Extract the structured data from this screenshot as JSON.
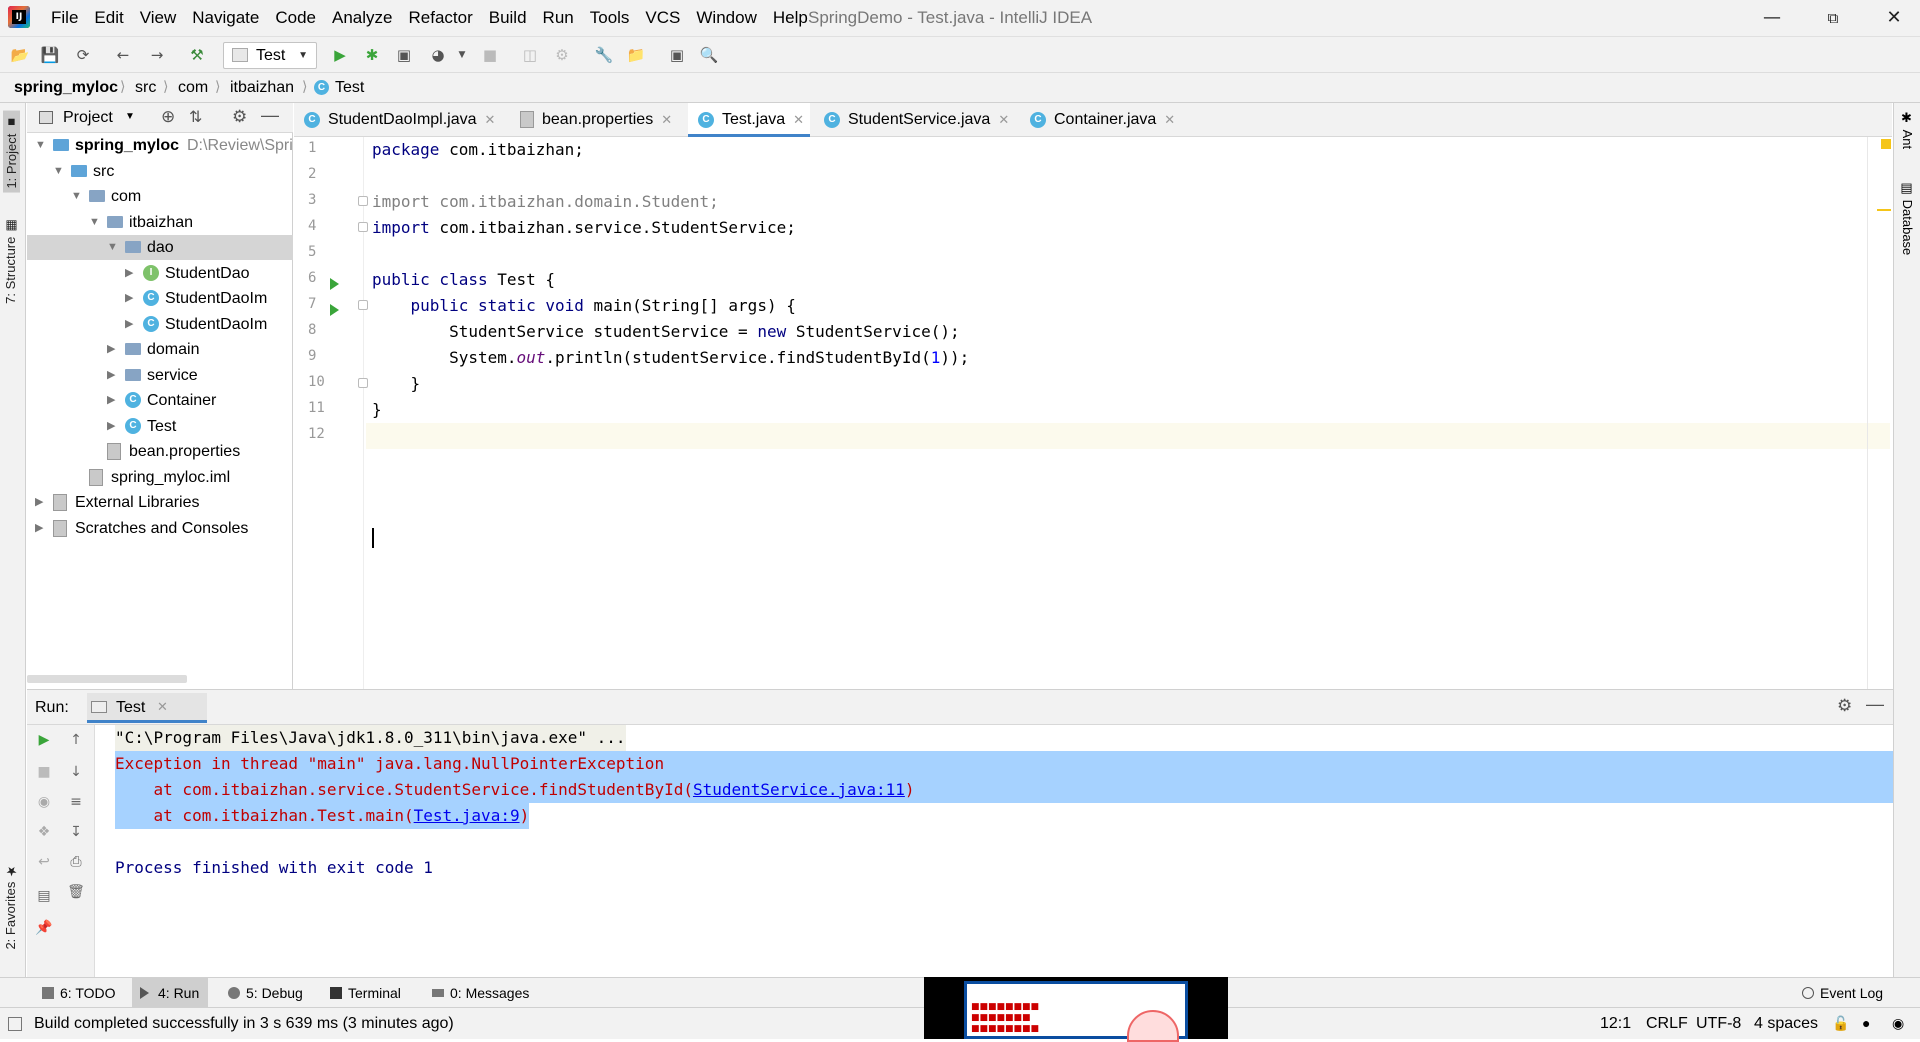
{
  "window": {
    "title": "SpringDemo - Test.java - IntelliJ IDEA",
    "logo_text": "IJ"
  },
  "menu": [
    "File",
    "Edit",
    "View",
    "Navigate",
    "Code",
    "Analyze",
    "Refactor",
    "Build",
    "Run",
    "Tools",
    "VCS",
    "Window",
    "Help"
  ],
  "toolbar": {
    "run_config": "Test"
  },
  "breadcrumb": [
    "spring_myloc",
    "src",
    "com",
    "itbaizhan",
    "Test"
  ],
  "project_panel": {
    "title": "Project",
    "tree": [
      {
        "label": "spring_myloc",
        "hint": "D:\\Review\\Spri",
        "depth": 0,
        "icon": "module-icon",
        "expanded": true,
        "bold": true
      },
      {
        "label": "src",
        "depth": 1,
        "icon": "source-folder-icon",
        "expanded": true
      },
      {
        "label": "com",
        "depth": 2,
        "icon": "package-icon",
        "expanded": true
      },
      {
        "label": "itbaizhan",
        "depth": 3,
        "icon": "package-icon",
        "expanded": true
      },
      {
        "label": "dao",
        "depth": 4,
        "icon": "package-icon",
        "expanded": true,
        "selected": true
      },
      {
        "label": "StudentDao",
        "depth": 5,
        "icon": "interface-icon",
        "expanded": false
      },
      {
        "label": "StudentDaoIm",
        "depth": 5,
        "icon": "class-icon",
        "expanded": false
      },
      {
        "label": "StudentDaoIm",
        "depth": 5,
        "icon": "class-icon",
        "expanded": false
      },
      {
        "label": "domain",
        "depth": 4,
        "icon": "package-icon",
        "expanded": false
      },
      {
        "label": "service",
        "depth": 4,
        "icon": "package-icon",
        "expanded": false
      },
      {
        "label": "Container",
        "depth": 4,
        "icon": "class-icon",
        "expanded": false
      },
      {
        "label": "Test",
        "depth": 4,
        "icon": "runnable-class-icon",
        "expanded": false
      },
      {
        "label": "bean.properties",
        "depth": 3,
        "icon": "properties-file-icon",
        "leaf": true
      },
      {
        "label": "spring_myloc.iml",
        "depth": 2,
        "icon": "iml-file-icon",
        "leaf": true
      },
      {
        "label": "External Libraries",
        "depth": 0,
        "icon": "library-icon",
        "expanded": false
      },
      {
        "label": "Scratches and Consoles",
        "depth": 0,
        "icon": "scratches-icon",
        "expanded": false
      }
    ]
  },
  "editor_tabs": [
    {
      "label": "StudentDaoImpl.java",
      "icon": "class-icon",
      "active": false
    },
    {
      "label": "bean.properties",
      "icon": "properties-file-icon",
      "active": false
    },
    {
      "label": "Test.java",
      "icon": "runnable-class-icon",
      "active": true
    },
    {
      "label": "StudentService.java",
      "icon": "class-icon",
      "active": false
    },
    {
      "label": "Container.java",
      "icon": "class-icon",
      "active": false
    }
  ],
  "code_lines": [
    {
      "n": "1"
    },
    {
      "n": "2"
    },
    {
      "n": "3"
    },
    {
      "n": "4"
    },
    {
      "n": "5"
    },
    {
      "n": "6"
    },
    {
      "n": "7"
    },
    {
      "n": "8"
    },
    {
      "n": "9"
    },
    {
      "n": "10"
    },
    {
      "n": "11"
    },
    {
      "n": "12"
    }
  ],
  "code": {
    "l1_kw": "package",
    "l1_rest": " com.itbaizhan;",
    "l3": "import com.itbaizhan.domain.Student;",
    "l4_kw": "import",
    "l4_rest": " com.itbaizhan.service.StudentService;",
    "l6_kw": "public class",
    "l6_rest": " Test {",
    "l7_kw": "    public static void",
    "l7_rest": " main(String[] args) {",
    "l8_a": "        StudentService studentService = ",
    "l8_kw": "new",
    "l8_b": " StudentService();",
    "l9_a": "        System.",
    "l9_out": "out",
    "l9_b": ".println(studentService.findStudentById(",
    "l9_num": "1",
    "l9_c": "));",
    "l10": "    }",
    "l11": "}"
  },
  "run_panel": {
    "label": "Run:",
    "tab": "Test",
    "console": {
      "cmd": "\"C:\\Program Files\\Java\\jdk1.8.0_311\\bin\\java.exe\" ...",
      "exception": "Exception in thread \"main\" java.lang.NullPointerException",
      "trace1_pre": "    at com.itbaizhan.service.StudentService.findStudentById(",
      "trace1_link": "StudentService.java:11",
      "trace1_post": ")",
      "trace2_pre": "    at com.itbaizhan.Test.main(",
      "trace2_link": "Test.java:9",
      "trace2_post": ")",
      "finish": "Process finished with exit code 1"
    }
  },
  "tool_windows_bottom": [
    {
      "label": "6: TODO",
      "active": false
    },
    {
      "label": "4: Run",
      "active": true
    },
    {
      "label": "5: Debug",
      "active": false
    },
    {
      "label": "Terminal",
      "active": false
    },
    {
      "label": "0: Messages",
      "active": false
    }
  ],
  "event_log": "Event Log",
  "side_tabs": {
    "left_project": "1: Project",
    "left_structure": "7: Structure",
    "left_favorites": "2: Favorites",
    "right_ant": "Ant",
    "right_database": "Database"
  },
  "status": {
    "message": "Build completed successfully in 3 s 639 ms (3 minutes ago)",
    "position": "12:1",
    "line_sep": "CRLF",
    "encoding": "UTF-8",
    "indent": "4 spaces"
  },
  "colors": {
    "keyword": "#000080",
    "error": "#c00000",
    "highlight": "#a6d2ff",
    "active_tab_underline": "#4083c9"
  }
}
